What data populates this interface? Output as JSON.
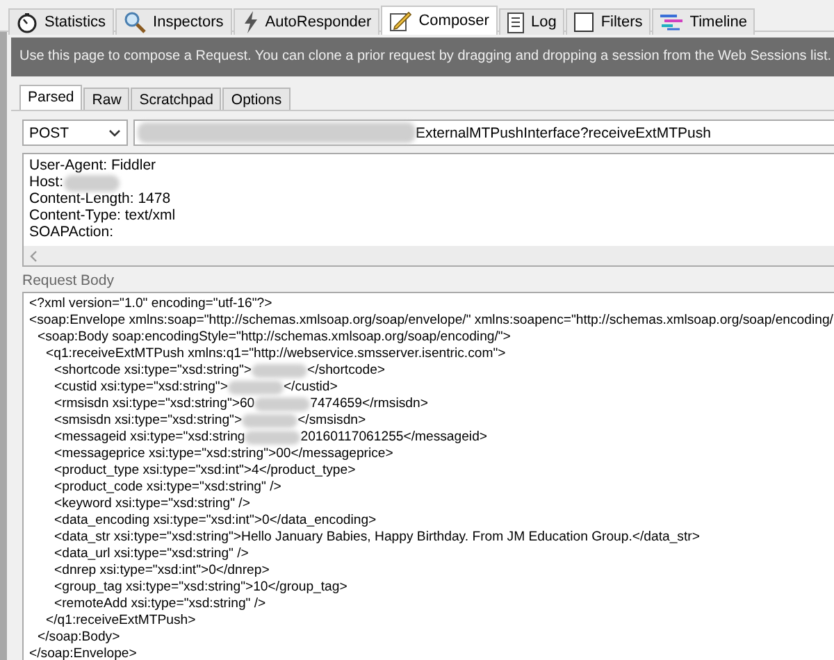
{
  "tabs": [
    {
      "label": "Statistics",
      "selected": false
    },
    {
      "label": "Inspectors",
      "selected": false
    },
    {
      "label": "AutoResponder",
      "selected": false
    },
    {
      "label": "Composer",
      "selected": true
    },
    {
      "label": "Log",
      "selected": false
    },
    {
      "label": "Filters",
      "selected": false
    },
    {
      "label": "Timeline",
      "selected": false
    }
  ],
  "banner": "Use this page to compose a Request. You can clone a prior request by dragging and dropping a session from the Web Sessions list.",
  "subtabs": [
    {
      "label": "Parsed",
      "selected": true
    },
    {
      "label": "Raw",
      "selected": false
    },
    {
      "label": "Scratchpad",
      "selected": false
    },
    {
      "label": "Options",
      "selected": false
    }
  ],
  "method": "POST",
  "url": [
    {
      "kind": "redacted"
    },
    {
      "kind": "text",
      "text": "ExternalMTPushInterface?receiveExtMTPush"
    }
  ],
  "headers": [
    [
      {
        "kind": "text",
        "text": "User-Agent: Fiddler"
      }
    ],
    [
      {
        "kind": "text",
        "text": "Host:"
      },
      {
        "kind": "redacted"
      }
    ],
    [
      {
        "kind": "text",
        "text": "Content-Length: 1478"
      }
    ],
    [
      {
        "kind": "text",
        "text": "Content-Type: text/xml"
      }
    ],
    [
      {
        "kind": "text",
        "text": "SOAPAction:"
      }
    ]
  ],
  "request_body_label": "Request Body",
  "body": [
    {
      "parts": [
        {
          "kind": "text",
          "text": "<?xml version=\"1.0\" encoding=\"utf-16\"?>"
        }
      ]
    },
    {
      "parts": [
        {
          "kind": "text",
          "text": "<soap:Envelope xmlns:soap=\"http://schemas.xmlsoap.org/soap/envelope/\" xmlns:soapenc=\"http://schemas.xmlsoap.org/soap/encoding/"
        }
      ],
      "close": "</soap:Envelope>",
      "children": [
        {
          "parts": [
            {
              "kind": "text",
              "text": "<soap:Body soap:encodingStyle=\"http://schemas.xmlsoap.org/soap/encoding/\">"
            }
          ],
          "close": "</soap:Body>",
          "children": [
            {
              "parts": [
                {
                  "kind": "text",
                  "text": "<q1:receiveExtMTPush xmlns:q1=\"http://webservice.smsserver.isentric.com\">"
                }
              ],
              "close": "</q1:receiveExtMTPush>",
              "children": [
                {
                  "parts": [
                    {
                      "kind": "text",
                      "text": "<shortcode xsi:type=\"xsd:string\">"
                    },
                    {
                      "kind": "redacted"
                    },
                    {
                      "kind": "text",
                      "text": "</shortcode>"
                    }
                  ]
                },
                {
                  "parts": [
                    {
                      "kind": "text",
                      "text": "<custid xsi:type=\"xsd:string\">"
                    },
                    {
                      "kind": "redacted"
                    },
                    {
                      "kind": "text",
                      "text": "</custid>"
                    }
                  ]
                },
                {
                  "parts": [
                    {
                      "kind": "text",
                      "text": "<rmsisdn xsi:type=\"xsd:string\">60"
                    },
                    {
                      "kind": "redacted"
                    },
                    {
                      "kind": "text",
                      "text": "7474659</rmsisdn>"
                    }
                  ]
                },
                {
                  "parts": [
                    {
                      "kind": "text",
                      "text": "<smsisdn xsi:type=\"xsd:string\">"
                    },
                    {
                      "kind": "redacted"
                    },
                    {
                      "kind": "text",
                      "text": "</smsisdn>"
                    }
                  ]
                },
                {
                  "parts": [
                    {
                      "kind": "text",
                      "text": "<messageid xsi:type=\"xsd:string"
                    },
                    {
                      "kind": "redacted"
                    },
                    {
                      "kind": "text",
                      "text": "20160117061255</messageid>"
                    }
                  ]
                },
                {
                  "parts": [
                    {
                      "kind": "text",
                      "text": "<messageprice xsi:type=\"xsd:string\">00</messageprice>"
                    }
                  ]
                },
                {
                  "parts": [
                    {
                      "kind": "text",
                      "text": "<product_type xsi:type=\"xsd:int\">4</product_type>"
                    }
                  ]
                },
                {
                  "parts": [
                    {
                      "kind": "text",
                      "text": "<product_code xsi:type=\"xsd:string\" />"
                    }
                  ]
                },
                {
                  "parts": [
                    {
                      "kind": "text",
                      "text": "<keyword xsi:type=\"xsd:string\" />"
                    }
                  ]
                },
                {
                  "parts": [
                    {
                      "kind": "text",
                      "text": "<data_encoding xsi:type=\"xsd:int\">0</data_encoding>"
                    }
                  ]
                },
                {
                  "parts": [
                    {
                      "kind": "text",
                      "text": "<data_str xsi:type=\"xsd:string\">Hello January Babies, Happy Birthday. From JM Education Group.</data_str>"
                    }
                  ]
                },
                {
                  "parts": [
                    {
                      "kind": "text",
                      "text": "<data_url xsi:type=\"xsd:string\" />"
                    }
                  ]
                },
                {
                  "parts": [
                    {
                      "kind": "text",
                      "text": "<dnrep xsi:type=\"xsd:int\">0</dnrep>"
                    }
                  ]
                },
                {
                  "parts": [
                    {
                      "kind": "text",
                      "text": "<group_tag xsi:type=\"xsd:string\">10</group_tag>"
                    }
                  ]
                },
                {
                  "parts": [
                    {
                      "kind": "text",
                      "text": "<remoteAdd xsi:type=\"xsd:string\" />"
                    }
                  ]
                }
              ]
            }
          ]
        }
      ]
    }
  ]
}
